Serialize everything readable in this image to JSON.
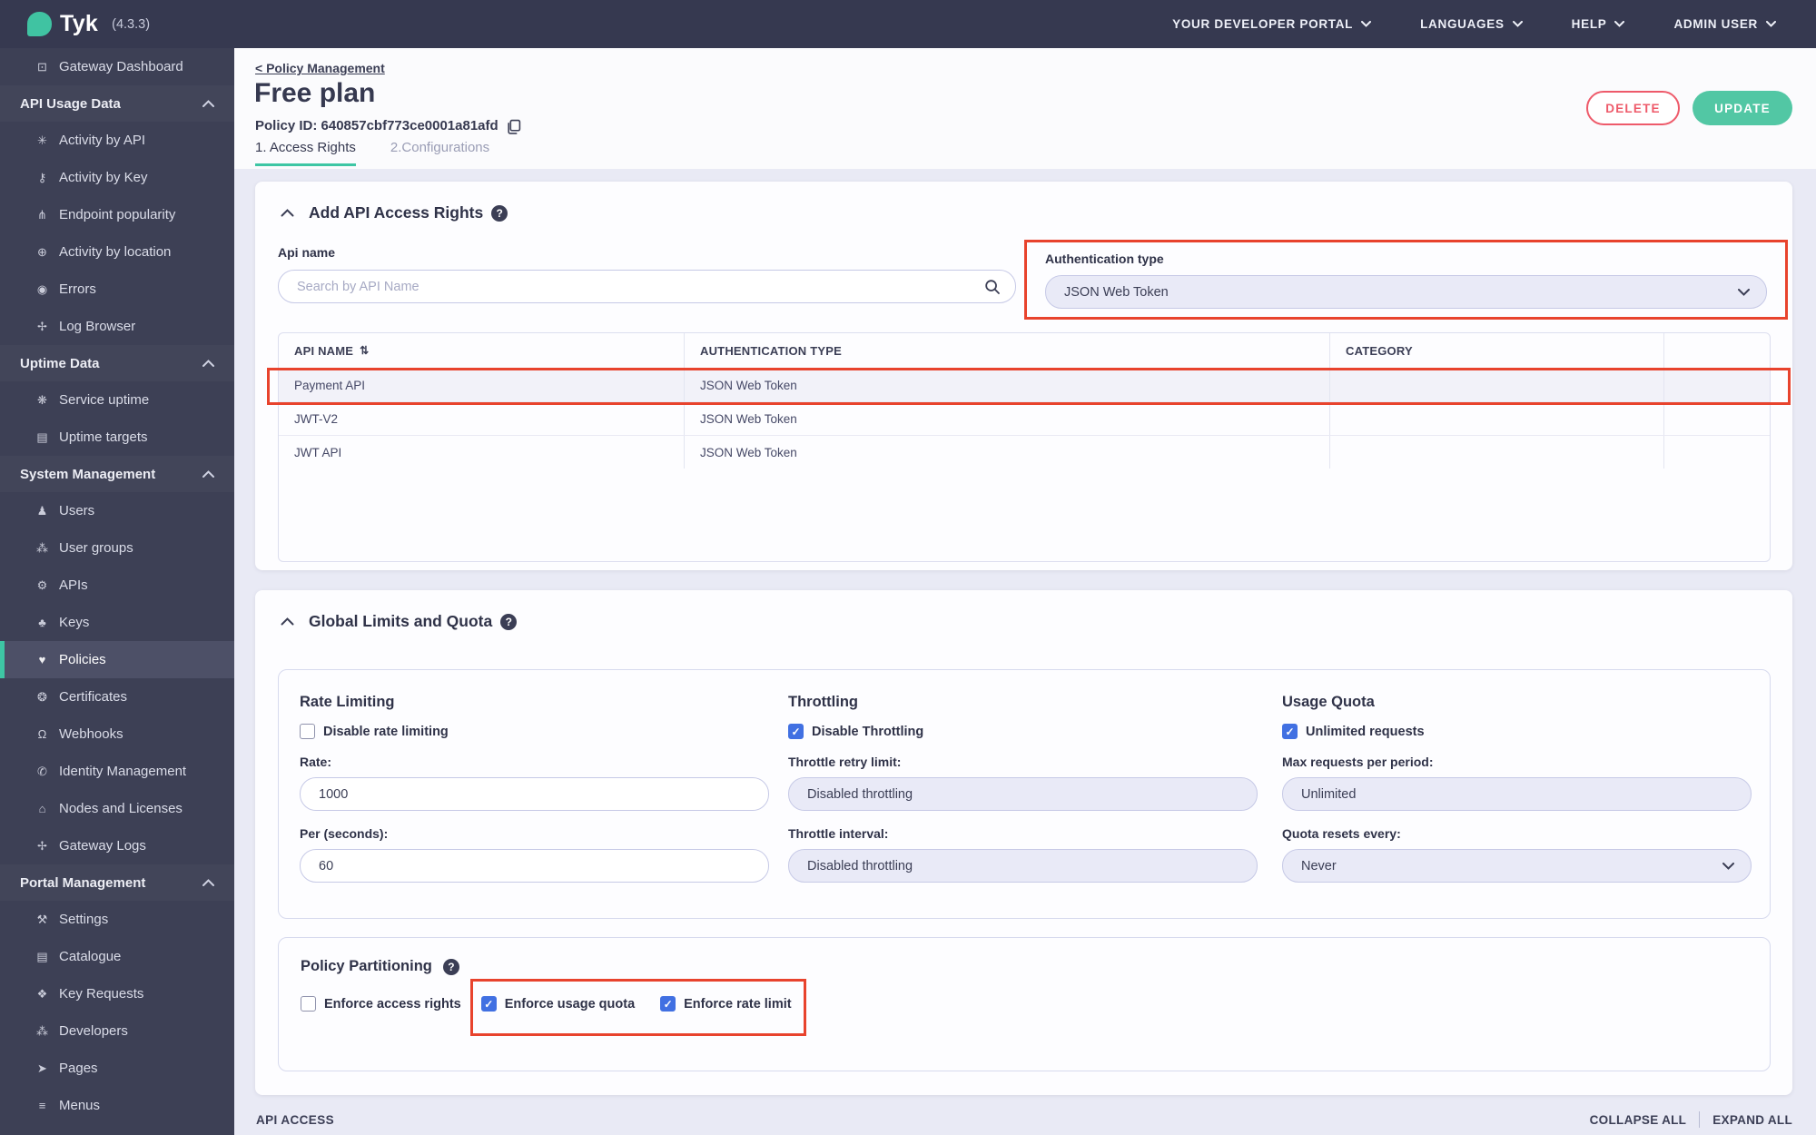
{
  "topbar": {
    "brand": "Tyk",
    "version": "(4.3.3)",
    "nav": [
      {
        "label": "YOUR DEVELOPER PORTAL"
      },
      {
        "label": "LANGUAGES"
      },
      {
        "label": "HELP"
      },
      {
        "label": "ADMIN USER"
      }
    ]
  },
  "sidebar": {
    "standalone": {
      "label": "Gateway Dashboard",
      "icon": "⊡"
    },
    "sections": [
      {
        "label": "API Usage Data",
        "items": [
          {
            "label": "Activity by API",
            "icon": "✳"
          },
          {
            "label": "Activity by Key",
            "icon": "⚷"
          },
          {
            "label": "Endpoint popularity",
            "icon": "⋔"
          },
          {
            "label": "Activity by location",
            "icon": "⊕"
          },
          {
            "label": "Errors",
            "icon": "◉"
          },
          {
            "label": "Log Browser",
            "icon": "✢"
          }
        ]
      },
      {
        "label": "Uptime Data",
        "items": [
          {
            "label": "Service uptime",
            "icon": "❋"
          },
          {
            "label": "Uptime targets",
            "icon": "▤"
          }
        ]
      },
      {
        "label": "System Management",
        "items": [
          {
            "label": "Users",
            "icon": "♟"
          },
          {
            "label": "User groups",
            "icon": "⁂"
          },
          {
            "label": "APIs",
            "icon": "⚙"
          },
          {
            "label": "Keys",
            "icon": "♣"
          },
          {
            "label": "Policies",
            "icon": "♥",
            "active": true
          },
          {
            "label": "Certificates",
            "icon": "❂"
          },
          {
            "label": "Webhooks",
            "icon": "Ω"
          },
          {
            "label": "Identity Management",
            "icon": "✆"
          },
          {
            "label": "Nodes and Licenses",
            "icon": "⌂"
          },
          {
            "label": "Gateway Logs",
            "icon": "✢"
          }
        ]
      },
      {
        "label": "Portal Management",
        "items": [
          {
            "label": "Settings",
            "icon": "⚒"
          },
          {
            "label": "Catalogue",
            "icon": "▤"
          },
          {
            "label": "Key Requests",
            "icon": "❖"
          },
          {
            "label": "Developers",
            "icon": "⁂"
          },
          {
            "label": "Pages",
            "icon": "➤"
          },
          {
            "label": "Menus",
            "icon": "≡"
          }
        ]
      }
    ]
  },
  "header": {
    "breadcrumb": "< Policy Management",
    "title": "Free plan",
    "policy_id": "Policy ID: 640857cbf773ce0001a81afd",
    "tabs": [
      {
        "label": "1. Access Rights",
        "active": true
      },
      {
        "label": "2.Configurations",
        "active": false
      }
    ],
    "delete_label": "DELETE",
    "update_label": "UPDATE"
  },
  "access_section": {
    "title": "Add API Access Rights",
    "api_name_label": "Api name",
    "search_placeholder": "Search by API Name",
    "auth_label": "Authentication type",
    "auth_value": "JSON Web Token",
    "table": {
      "headers": [
        "API NAME",
        "AUTHENTICATION TYPE",
        "CATEGORY",
        ""
      ],
      "rows": [
        {
          "api_name": "Payment API",
          "auth_type": "JSON Web Token",
          "category": "",
          "highlighted": true
        },
        {
          "api_name": "JWT-V2",
          "auth_type": "JSON Web Token",
          "category": ""
        },
        {
          "api_name": "JWT API",
          "auth_type": "JSON Web Token",
          "category": ""
        }
      ]
    }
  },
  "limits_section": {
    "title": "Global Limits and Quota",
    "rate": {
      "heading": "Rate Limiting",
      "checkbox_label": "Disable rate limiting",
      "checkbox_checked": false,
      "rate_label": "Rate:",
      "rate_value": "1000",
      "per_label": "Per (seconds):",
      "per_value": "60"
    },
    "throttle": {
      "heading": "Throttling",
      "checkbox_label": "Disable Throttling",
      "checkbox_checked": true,
      "retry_label": "Throttle retry limit:",
      "retry_value": "Disabled throttling",
      "interval_label": "Throttle interval:",
      "interval_value": "Disabled throttling"
    },
    "quota": {
      "heading": "Usage Quota",
      "checkbox_label": "Unlimited requests",
      "checkbox_checked": true,
      "max_label": "Max requests per period:",
      "max_value": "Unlimited",
      "resets_label": "Quota resets every:",
      "resets_value": "Never"
    }
  },
  "partition_section": {
    "title": "Policy Partitioning",
    "checkboxes": [
      {
        "label": "Enforce access rights",
        "checked": false
      },
      {
        "label": "Enforce usage quota",
        "checked": true
      },
      {
        "label": "Enforce rate limit",
        "checked": true
      }
    ]
  },
  "footer": {
    "left_label": "API ACCESS",
    "collapse_label": "COLLAPSE ALL",
    "expand_label": "EXPAND ALL"
  },
  "icons": {
    "check": "✓",
    "sort": "⇅",
    "help": "?"
  },
  "colors": {
    "brand_teal": "#3ec6a4",
    "update_green": "#52c7a4",
    "delete_red": "#ee5a6a",
    "annotation_red": "#e8432d",
    "checkbox_blue": "#4170e2",
    "sidebar_dark": "#3d4055",
    "page_background": "#e9eaf5"
  }
}
